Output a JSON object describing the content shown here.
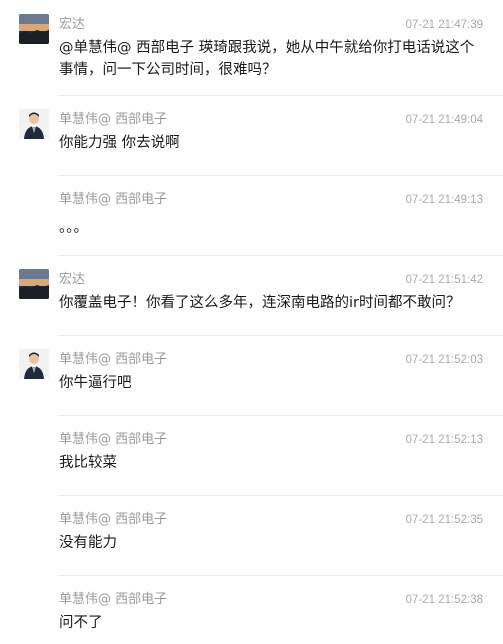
{
  "messages": [
    {
      "name": "宏达",
      "time": "07-21 21:47:39",
      "avatar": "sunset",
      "text": "@单慧伟@ 西部电子 瑛琦跟我说，她从中午就给你打电话说这个事情，问一下公司时间，很难吗？"
    },
    {
      "name": "单慧伟@ 西部电子",
      "time": "07-21 21:49:04",
      "avatar": "person",
      "text": "你能力强 你去说啊"
    },
    {
      "name": "单慧伟@ 西部电子",
      "time": "07-21 21:49:13",
      "avatar": "",
      "text": "。。。"
    },
    {
      "name": "宏达",
      "time": "07-21 21:51:42",
      "avatar": "sunset",
      "text": "你覆盖电子！你看了这么多年，连深南电路的ir时间都不敢问？"
    },
    {
      "name": "单慧伟@ 西部电子",
      "time": "07-21 21:52:03",
      "avatar": "person",
      "text": "你牛逼行吧"
    },
    {
      "name": "单慧伟@ 西部电子",
      "time": "07-21 21:52:13",
      "avatar": "",
      "text": "我比较菜"
    },
    {
      "name": "单慧伟@ 西部电子",
      "time": "07-21 21:52:35",
      "avatar": "",
      "text": "没有能力"
    },
    {
      "name": "单慧伟@ 西部电子",
      "time": "07-21 21:52:38",
      "avatar": "",
      "text": "问不了"
    }
  ]
}
